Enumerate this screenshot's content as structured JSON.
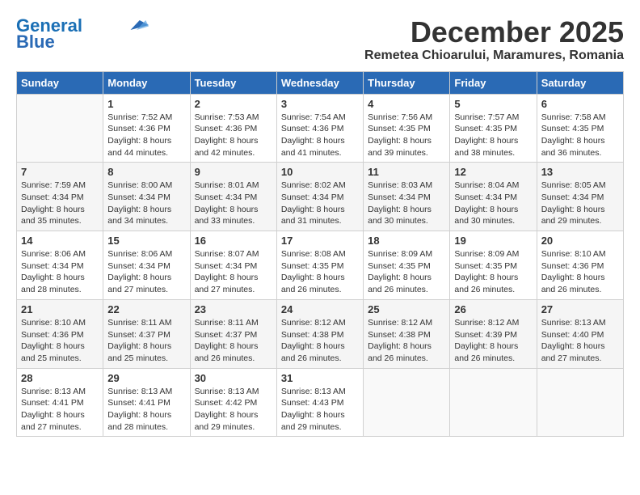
{
  "header": {
    "logo_line1": "General",
    "logo_line2": "Blue",
    "month": "December 2025",
    "location": "Remetea Chioarului, Maramures, Romania"
  },
  "weekdays": [
    "Sunday",
    "Monday",
    "Tuesday",
    "Wednesday",
    "Thursday",
    "Friday",
    "Saturday"
  ],
  "weeks": [
    [
      {
        "day": "",
        "info": ""
      },
      {
        "day": "1",
        "info": "Sunrise: 7:52 AM\nSunset: 4:36 PM\nDaylight: 8 hours\nand 44 minutes."
      },
      {
        "day": "2",
        "info": "Sunrise: 7:53 AM\nSunset: 4:36 PM\nDaylight: 8 hours\nand 42 minutes."
      },
      {
        "day": "3",
        "info": "Sunrise: 7:54 AM\nSunset: 4:36 PM\nDaylight: 8 hours\nand 41 minutes."
      },
      {
        "day": "4",
        "info": "Sunrise: 7:56 AM\nSunset: 4:35 PM\nDaylight: 8 hours\nand 39 minutes."
      },
      {
        "day": "5",
        "info": "Sunrise: 7:57 AM\nSunset: 4:35 PM\nDaylight: 8 hours\nand 38 minutes."
      },
      {
        "day": "6",
        "info": "Sunrise: 7:58 AM\nSunset: 4:35 PM\nDaylight: 8 hours\nand 36 minutes."
      }
    ],
    [
      {
        "day": "7",
        "info": "Sunrise: 7:59 AM\nSunset: 4:34 PM\nDaylight: 8 hours\nand 35 minutes."
      },
      {
        "day": "8",
        "info": "Sunrise: 8:00 AM\nSunset: 4:34 PM\nDaylight: 8 hours\nand 34 minutes."
      },
      {
        "day": "9",
        "info": "Sunrise: 8:01 AM\nSunset: 4:34 PM\nDaylight: 8 hours\nand 33 minutes."
      },
      {
        "day": "10",
        "info": "Sunrise: 8:02 AM\nSunset: 4:34 PM\nDaylight: 8 hours\nand 31 minutes."
      },
      {
        "day": "11",
        "info": "Sunrise: 8:03 AM\nSunset: 4:34 PM\nDaylight: 8 hours\nand 30 minutes."
      },
      {
        "day": "12",
        "info": "Sunrise: 8:04 AM\nSunset: 4:34 PM\nDaylight: 8 hours\nand 30 minutes."
      },
      {
        "day": "13",
        "info": "Sunrise: 8:05 AM\nSunset: 4:34 PM\nDaylight: 8 hours\nand 29 minutes."
      }
    ],
    [
      {
        "day": "14",
        "info": "Sunrise: 8:06 AM\nSunset: 4:34 PM\nDaylight: 8 hours\nand 28 minutes."
      },
      {
        "day": "15",
        "info": "Sunrise: 8:06 AM\nSunset: 4:34 PM\nDaylight: 8 hours\nand 27 minutes."
      },
      {
        "day": "16",
        "info": "Sunrise: 8:07 AM\nSunset: 4:34 PM\nDaylight: 8 hours\nand 27 minutes."
      },
      {
        "day": "17",
        "info": "Sunrise: 8:08 AM\nSunset: 4:35 PM\nDaylight: 8 hours\nand 26 minutes."
      },
      {
        "day": "18",
        "info": "Sunrise: 8:09 AM\nSunset: 4:35 PM\nDaylight: 8 hours\nand 26 minutes."
      },
      {
        "day": "19",
        "info": "Sunrise: 8:09 AM\nSunset: 4:35 PM\nDaylight: 8 hours\nand 26 minutes."
      },
      {
        "day": "20",
        "info": "Sunrise: 8:10 AM\nSunset: 4:36 PM\nDaylight: 8 hours\nand 26 minutes."
      }
    ],
    [
      {
        "day": "21",
        "info": "Sunrise: 8:10 AM\nSunset: 4:36 PM\nDaylight: 8 hours\nand 25 minutes."
      },
      {
        "day": "22",
        "info": "Sunrise: 8:11 AM\nSunset: 4:37 PM\nDaylight: 8 hours\nand 25 minutes."
      },
      {
        "day": "23",
        "info": "Sunrise: 8:11 AM\nSunset: 4:37 PM\nDaylight: 8 hours\nand 26 minutes."
      },
      {
        "day": "24",
        "info": "Sunrise: 8:12 AM\nSunset: 4:38 PM\nDaylight: 8 hours\nand 26 minutes."
      },
      {
        "day": "25",
        "info": "Sunrise: 8:12 AM\nSunset: 4:38 PM\nDaylight: 8 hours\nand 26 minutes."
      },
      {
        "day": "26",
        "info": "Sunrise: 8:12 AM\nSunset: 4:39 PM\nDaylight: 8 hours\nand 26 minutes."
      },
      {
        "day": "27",
        "info": "Sunrise: 8:13 AM\nSunset: 4:40 PM\nDaylight: 8 hours\nand 27 minutes."
      }
    ],
    [
      {
        "day": "28",
        "info": "Sunrise: 8:13 AM\nSunset: 4:41 PM\nDaylight: 8 hours\nand 27 minutes."
      },
      {
        "day": "29",
        "info": "Sunrise: 8:13 AM\nSunset: 4:41 PM\nDaylight: 8 hours\nand 28 minutes."
      },
      {
        "day": "30",
        "info": "Sunrise: 8:13 AM\nSunset: 4:42 PM\nDaylight: 8 hours\nand 29 minutes."
      },
      {
        "day": "31",
        "info": "Sunrise: 8:13 AM\nSunset: 4:43 PM\nDaylight: 8 hours\nand 29 minutes."
      },
      {
        "day": "",
        "info": ""
      },
      {
        "day": "",
        "info": ""
      },
      {
        "day": "",
        "info": ""
      }
    ]
  ]
}
